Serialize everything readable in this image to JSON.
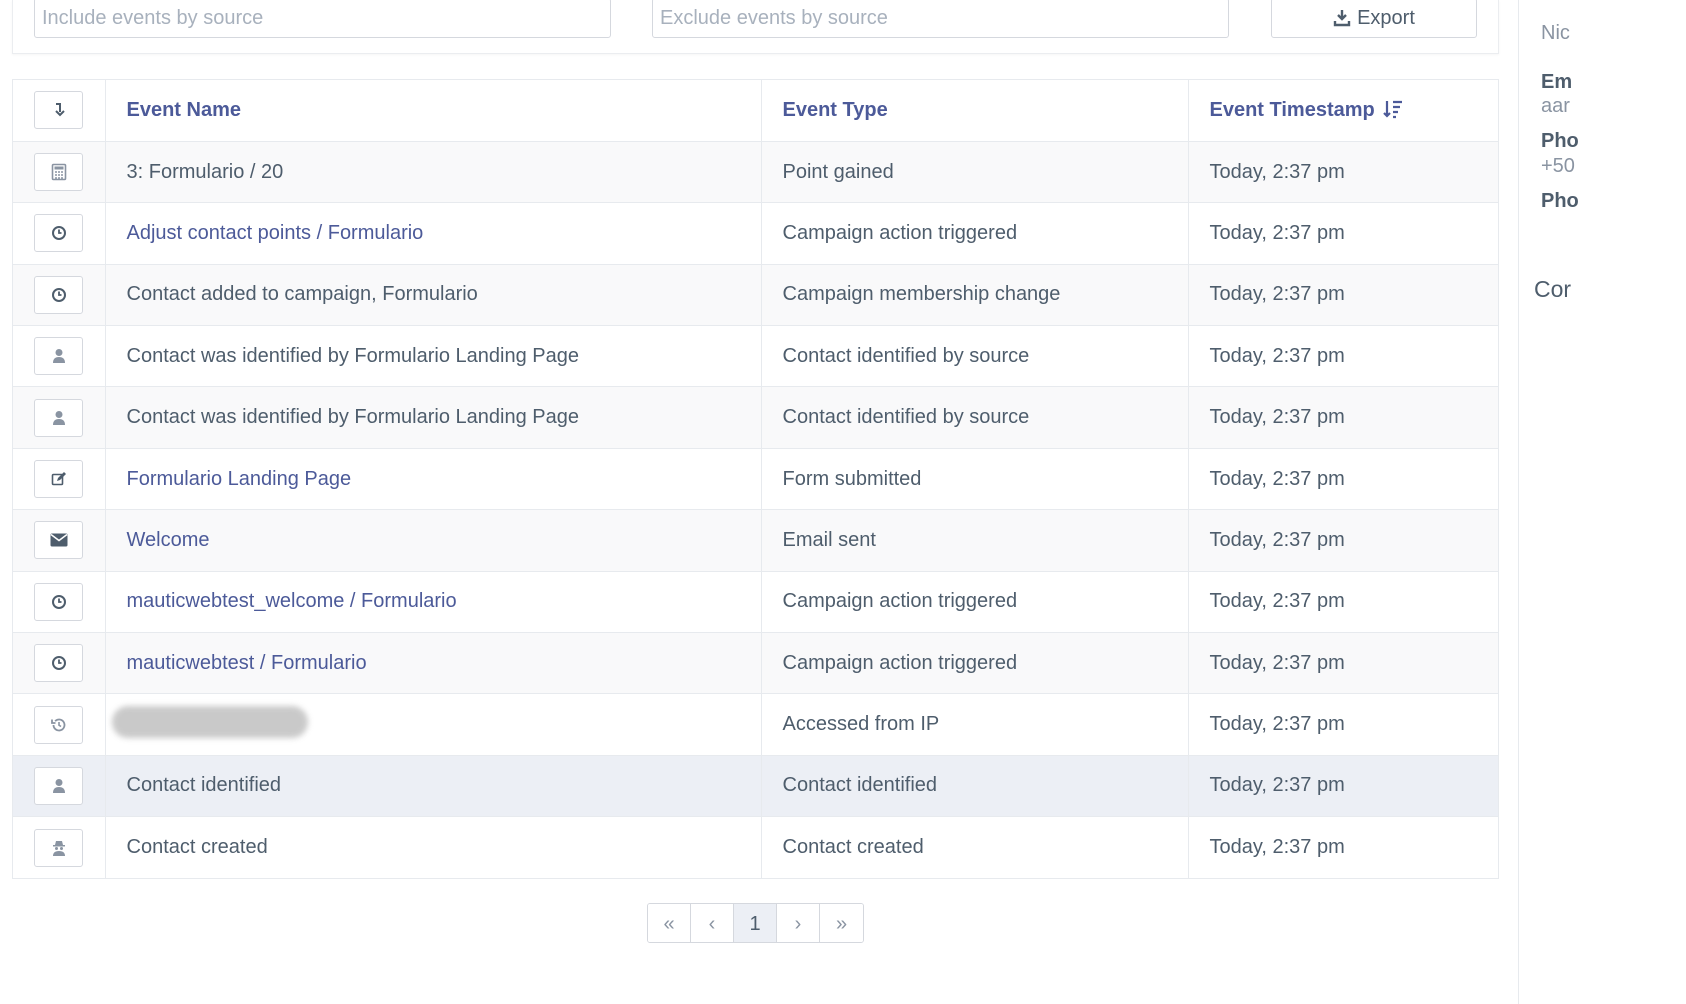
{
  "filters": {
    "include_placeholder": "Include events by source",
    "exclude_placeholder": "Exclude events by source",
    "export_label": "Export"
  },
  "table": {
    "columns": [
      "Event Name",
      "Event Type",
      "Event Timestamp"
    ],
    "rows": [
      {
        "icon": "calculator-icon",
        "name": "3: Formulario / 20",
        "link": false,
        "type": "Point gained",
        "time": "Today, 2:37 pm"
      },
      {
        "icon": "clock-icon",
        "name": "Adjust contact points / Formulario",
        "link": true,
        "type": "Campaign action triggered",
        "time": "Today, 2:37 pm"
      },
      {
        "icon": "clock-icon",
        "name": "Contact added to campaign, Formulario",
        "link": false,
        "type": "Campaign membership change",
        "time": "Today, 2:37 pm"
      },
      {
        "icon": "user-icon",
        "name": "Contact was identified by Formulario Landing Page",
        "link": false,
        "type": "Contact identified by source",
        "time": "Today, 2:37 pm"
      },
      {
        "icon": "user-icon",
        "name": "Contact was identified by Formulario Landing Page",
        "link": false,
        "type": "Contact identified by source",
        "time": "Today, 2:37 pm"
      },
      {
        "icon": "edit-icon",
        "name": "Formulario Landing Page",
        "link": true,
        "type": "Form submitted",
        "time": "Today, 2:37 pm"
      },
      {
        "icon": "envelope-icon",
        "name": "Welcome",
        "link": true,
        "type": "Email sent",
        "time": "Today, 2:37 pm"
      },
      {
        "icon": "clock-icon",
        "name": "mauticwebtest_welcome / Formulario",
        "link": true,
        "type": "Campaign action triggered",
        "time": "Today, 2:37 pm"
      },
      {
        "icon": "clock-icon",
        "name": "mauticwebtest / Formulario",
        "link": true,
        "type": "Campaign action triggered",
        "time": "Today, 2:37 pm"
      },
      {
        "icon": "history-icon",
        "name": "",
        "link": false,
        "blurred": true,
        "type": "Accessed from IP",
        "time": "Today, 2:37 pm"
      },
      {
        "icon": "user-icon",
        "name": "Contact identified",
        "link": false,
        "type": "Contact identified",
        "time": "Today, 2:37 pm",
        "highlight": true
      },
      {
        "icon": "user-secret-icon",
        "name": "Contact created",
        "link": false,
        "type": "Contact created",
        "time": "Today, 2:37 pm"
      }
    ]
  },
  "pagination": {
    "first": "«",
    "prev": "‹",
    "current": "1",
    "next": "›",
    "last": "»"
  },
  "sidebar": {
    "nickname_partial": "Nic",
    "email_label_partial": "Em",
    "email_value_partial": "aar",
    "phone_label_partial": "Pho",
    "phone_value_partial": "+50",
    "phone2_label_partial": "Pho",
    "section_partial": "Cor"
  },
  "colors": {
    "link": "#4c5a99",
    "text": "#4e5d6c",
    "border": "#e7eaee",
    "highlight_row": "#eceff5"
  }
}
